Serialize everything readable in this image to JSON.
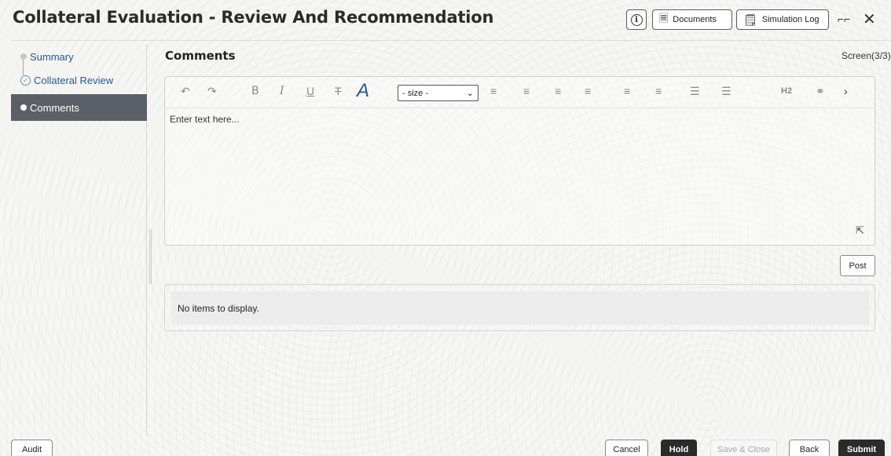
{
  "header": {
    "title": "Collateral Evaluation - Review And Recommendation",
    "documents_label": "Documents",
    "simulation_log_label": "Simulation Log"
  },
  "sidebar": {
    "items": [
      {
        "label": "Summary",
        "state": "pending"
      },
      {
        "label": "Collateral Review",
        "state": "completed"
      },
      {
        "label": "Comments",
        "state": "active"
      }
    ]
  },
  "main": {
    "section_title": "Comments",
    "screen_count": "Screen(3/3)",
    "editor": {
      "size_select_value": "- size -",
      "heading_label": "H2",
      "placeholder": "Enter text here..."
    },
    "post_label": "Post",
    "empty_list_text": "No items to display."
  },
  "footer": {
    "audit_label": "Audit",
    "cancel_label": "Cancel",
    "hold_label": "Hold",
    "save_close_label": "Save & Close",
    "back_label": "Back",
    "submit_label": "Submit"
  },
  "colors": {
    "active_nav_bg": "#5b6068",
    "primary_button_bg": "#2b2b2b",
    "nav_link": "#2a5a8a"
  }
}
